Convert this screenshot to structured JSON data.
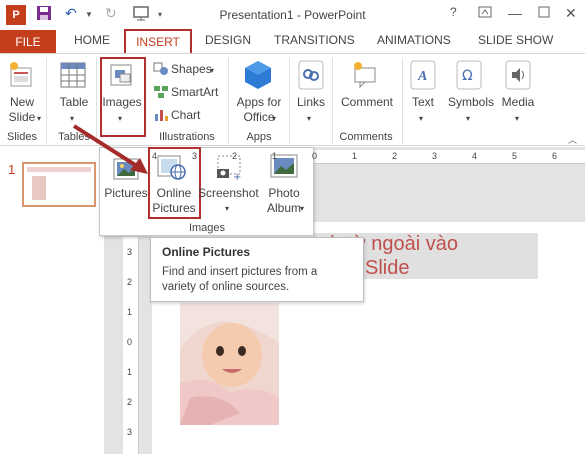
{
  "window": {
    "title": "Presentation1 - PowerPoint"
  },
  "tabs": [
    "FILE",
    "HOME",
    "INSERT",
    "DESIGN",
    "TRANSITIONS",
    "ANIMATIONS",
    "SLIDE SHOW"
  ],
  "ribbon": {
    "new_slide": {
      "line1": "New",
      "line2": "Slide"
    },
    "table": "Table",
    "images": "Images",
    "shapes": "Shapes",
    "smartart": "SmartArt",
    "chart": "Chart",
    "apps_for_office": {
      "line1": "Apps for",
      "line2": "Office"
    },
    "links": "Links",
    "comment": "Comment",
    "text": "Text",
    "symbols": "Symbols",
    "media": "Media",
    "groups": {
      "slides": "Slides",
      "tables": "Tables",
      "illustrations": "Illustrations",
      "apps": "Apps",
      "comments": "Comments"
    }
  },
  "images_dropdown": {
    "pictures": "Pictures",
    "online_pictures": {
      "line1": "Online",
      "line2": "Pictures"
    },
    "screenshot": "Screenshot",
    "photo_album": {
      "line1": "Photo",
      "line2": "Album"
    },
    "group_label": "Images"
  },
  "tooltip": {
    "title": "Online Pictures",
    "body_line1": "Find and insert pictures from a",
    "body_line2": "variety of online sources."
  },
  "slide_pane": {
    "slide_number": "1"
  },
  "slide": {
    "title_line1": "nh từ ngoài vào",
    "title_line2": "Slide"
  },
  "ruler": {
    "h": [
      "4",
      "3",
      "2",
      "1",
      "0",
      "1",
      "2",
      "3",
      "4",
      "5",
      "6"
    ],
    "v": [
      "3",
      "2",
      "1",
      "0",
      "1",
      "2",
      "3"
    ]
  },
  "colors": {
    "accent": "#c43e1c",
    "highlight_box": "#b03030",
    "slide_title": "#c0504d"
  }
}
